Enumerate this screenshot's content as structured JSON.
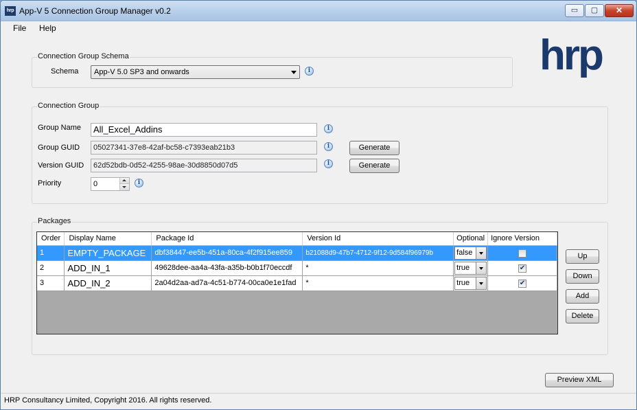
{
  "window": {
    "app_icon": "hrp",
    "title": "App-V 5 Connection Group Manager v0.2",
    "controls": {
      "minimize": "▭",
      "maximize": "▢",
      "close": "✕"
    }
  },
  "menu": {
    "file": "File",
    "help": "Help"
  },
  "logo": {
    "text": "hrp",
    "color": "#1b3a6b"
  },
  "schema_group": {
    "title": "Connection Group Schema",
    "schema_label": "Schema",
    "schema_value": "App-V 5.0 SP3 and onwards"
  },
  "connection_group": {
    "title": "Connection Group",
    "group_name_label": "Group Name",
    "group_name_value": "All_Excel_Addins",
    "group_guid_label": "Group GUID",
    "group_guid_value": "05027341-37e8-42af-bc58-c7393eab21b3",
    "version_guid_label": "Version GUID",
    "version_guid_value": "62d52bdb-0d52-4255-98ae-30d8850d07d5",
    "priority_label": "Priority",
    "priority_value": "0",
    "generate_label": "Generate"
  },
  "packages": {
    "title": "Packages",
    "columns": [
      "Order",
      "Display Name",
      "Package Id",
      "Version Id",
      "Optional",
      "Ignore Version"
    ],
    "rows": [
      {
        "order": "1",
        "display_name": "EMPTY_PACKAGE",
        "package_id": "dbf38447-ee5b-451a-80ca-4f2f915ee859",
        "version_id": "b21088d9-47b7-4712-9f12-9d584f96979b",
        "optional": "false",
        "ignore_version": false
      },
      {
        "order": "2",
        "display_name": "ADD_IN_1",
        "package_id": "49628dee-aa4a-43fa-a35b-b0b1f70eccdf",
        "version_id": "*",
        "optional": "true",
        "ignore_version": true
      },
      {
        "order": "3",
        "display_name": "ADD_IN_2",
        "package_id": "2a04d2aa-ad7a-4c51-b774-00ca0e1e1fad",
        "version_id": "*",
        "optional": "true",
        "ignore_version": true
      }
    ],
    "buttons": {
      "up": "Up",
      "down": "Down",
      "add": "Add",
      "delete": "Delete"
    }
  },
  "preview_xml_label": "Preview XML",
  "status": "HRP Consultancy Limited, Copyright 2016. All rights reserved.",
  "colors": {
    "selection": "#3399ff",
    "accent": "#1b3a6b"
  }
}
